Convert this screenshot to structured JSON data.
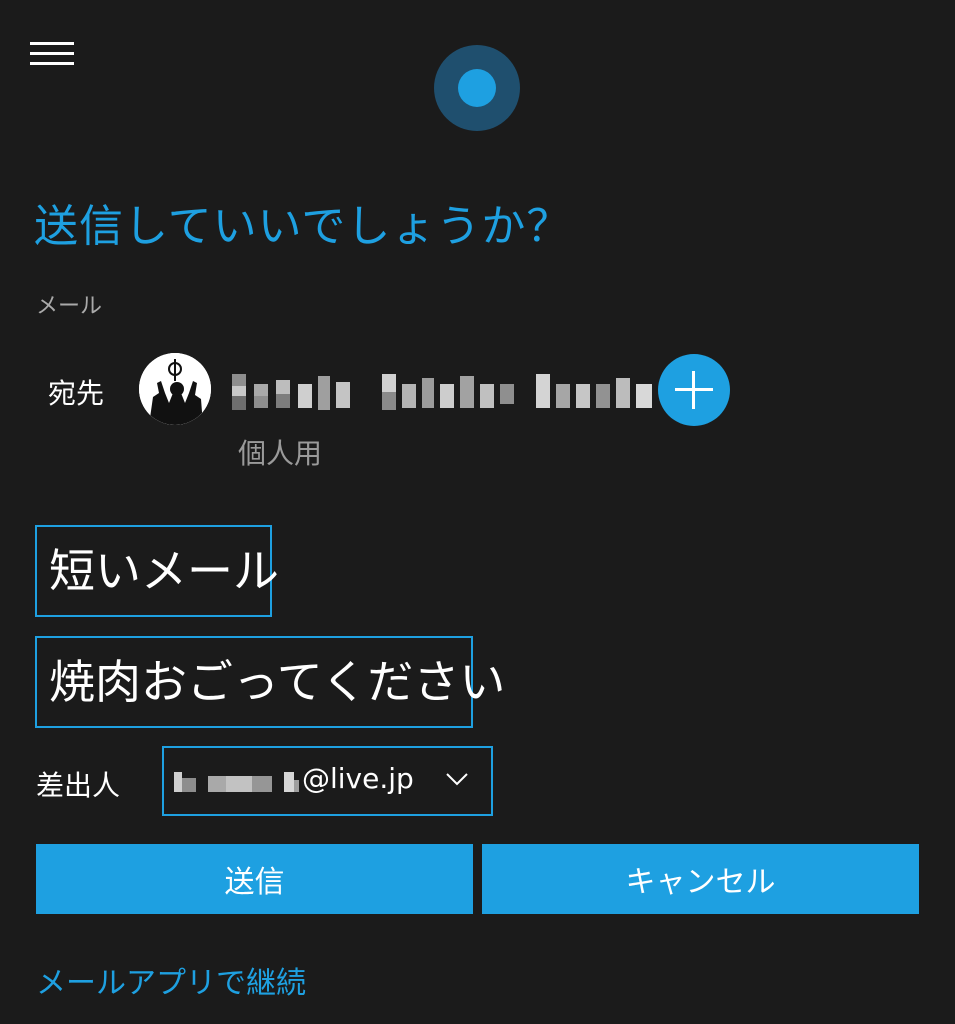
{
  "header": {
    "menu_icon": "hamburger-menu-icon",
    "assistant_icon": "cortana-orb-icon"
  },
  "prompt": {
    "question": "送信していいでしょうか？",
    "app_label": "メール"
  },
  "recipient": {
    "label": "宛先",
    "sub_label": "個人用",
    "add_icon": "plus-icon"
  },
  "message": {
    "subject": "短いメール",
    "body": "焼肉おごってください"
  },
  "sender": {
    "label": "差出人",
    "address_suffix": "@live.jp",
    "dropdown_icon": "chevron-down-icon"
  },
  "actions": {
    "send_label": "送信",
    "cancel_label": "キャンセル"
  },
  "footer": {
    "continue_link": "メールアプリで継続"
  },
  "colors": {
    "background": "#1b1b1b",
    "accent": "#1ea0e1",
    "orb_ring": "#1f4f6e",
    "secondary_text": "#9a9a9a"
  }
}
